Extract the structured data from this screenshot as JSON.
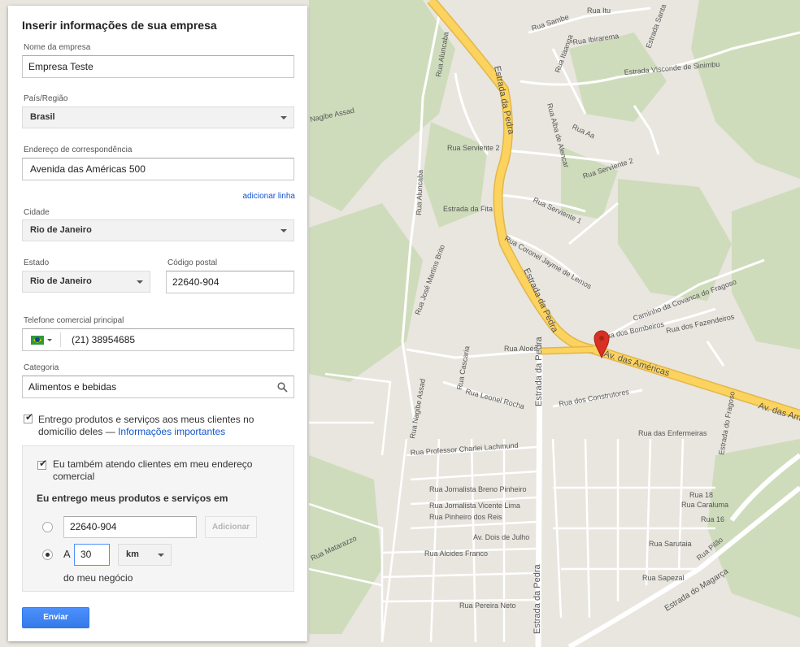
{
  "form": {
    "title": "Inserir informações de sua empresa",
    "company_name": {
      "label": "Nome da empresa",
      "value": "Empresa Teste"
    },
    "country": {
      "label": "País/Região",
      "value": "Brasil"
    },
    "address": {
      "label": "Endereço de correspondência",
      "value": "Avenida das Américas 500",
      "add_line": "adicionar linha"
    },
    "city": {
      "label": "Cidade",
      "value": "Rio de Janeiro"
    },
    "state": {
      "label": "Estado",
      "value": "Rio de Janeiro"
    },
    "postal": {
      "label": "Código postal",
      "value": "22640-904"
    },
    "phone": {
      "label": "Telefone comercial principal",
      "value": "(21) 38954685"
    },
    "category": {
      "label": "Categoria",
      "value": "Alimentos e bebidas"
    },
    "delivery": {
      "checked": true,
      "text": "Entrego produtos e serviços aos meus clientes no domicílio deles —",
      "link": "Informações importantes"
    },
    "service_area": {
      "also_serve": {
        "checked": true,
        "text": "Eu também atendo clientes em meu endereço comercial"
      },
      "heading": "Eu entrego meus produtos e serviços em",
      "option_postal": {
        "selected": false,
        "value": "22640-904",
        "add_button": "Adicionar"
      },
      "option_radius": {
        "selected": true,
        "prefix": "A",
        "distance": "30",
        "unit": "km",
        "suffix": "do meu negócio"
      }
    },
    "submit": "Enviar"
  },
  "map": {
    "colors": {
      "land": "#e8e6df",
      "green": "#cfdcbc",
      "road": "#ffffff",
      "highway": "#fbd35e",
      "highway_stroke": "#e4b648",
      "marker": "#d93025"
    },
    "labels": {
      "estrada_pedra": "Estrada da Pedra",
      "av_americas": "Av. das Américas",
      "rua_aluncaba": "Rua Aluncaba",
      "rua_itaanga": "Rua Itaanga",
      "rua_sambe": "Rua Sambe",
      "rua_ibirarema": "Rua Ibirarema",
      "rua_itu": "Rua Itu",
      "estrada_santa": "Estrada Santa",
      "estrada_visconde": "Estrada Visconde de Sinimbu",
      "rua_serviente_2": "Rua Serviente 2",
      "rua_serviente_1": "Rua Serviente 1",
      "rua_alba": "Rua Alba de Alencar",
      "rua_aa": "Rua Aa",
      "estrada_fita": "Estrada da Fita",
      "rua_coronel": "Rua Coronel Jayme de Lemos",
      "caminho_covanca": "Caminho da Covanca do Fragoso",
      "rua_bombeiros": "Rua dos Bombeiros",
      "rua_fazendeiros": "Rua dos Fazendeiros",
      "rua_aloes": "Rua Aloés",
      "rua_jose_martins": "Rua José Martins Brito",
      "rua_cascaria": "Rua Cascaria",
      "rua_leonel_rocha": "Rua Leonel Rocha",
      "rua_constructores": "Rua dos Construtores",
      "rua_nagibe_assad": "Rua Nagibe Assad",
      "rua_enfermeiras": "Rua das Enfermeiras",
      "rua_professor": "Rua Professor Charlei Lachmund",
      "rua_jornalista_breno": "Rua Jornalista Breno Pinheiro",
      "rua_jornalista_vicente": "Rua Jornalista Vicente Lima",
      "rua_pinheiro": "Rua Pinheiro dos Reis",
      "av_dois_julho": "Av. Dois de Julho",
      "rua_alcides": "Rua Alcides Franco",
      "rua_pereira": "Rua Pereira Neto",
      "rua_sarutaia": "Rua Sarutaia",
      "rua_sapezal": "Rua Sapezal",
      "rua_caraluma": "Rua Caraluma",
      "rua_16": "Rua 16",
      "rua_18": "Rua 18",
      "rua_pilao": "Rua Pilão",
      "estrada_magarca": "Estrada do Magarça",
      "estrada_fragoso": "Estrada do Fragoso",
      "rua_ahibe_assad": "Nagibe Assad",
      "rua_matarazzo": "Rua Matarazzo"
    }
  }
}
